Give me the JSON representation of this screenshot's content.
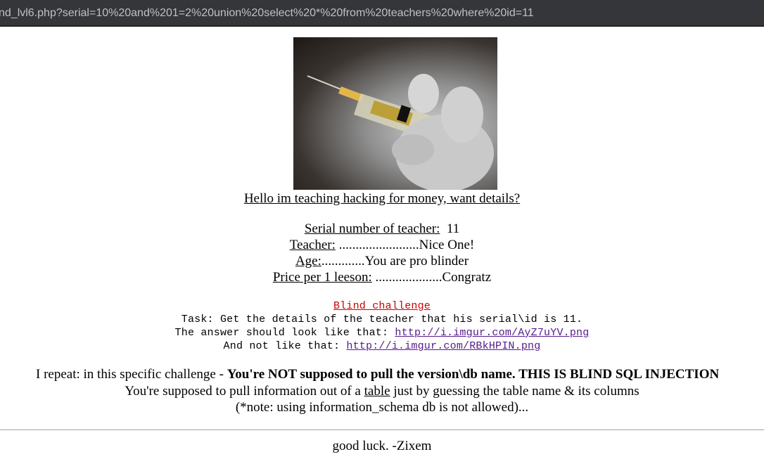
{
  "browser": {
    "url": "nd_lvl6.php?serial=10%20and%201=2%20union%20select%20*%20from%20teachers%20where%20id=11"
  },
  "header": {
    "headline": "Hello im teaching hacking for money, want details?"
  },
  "details": {
    "serial_label": "Serial number of teacher:",
    "serial_value": "11",
    "teacher_label": "Teacher:",
    "teacher_value": "........................Nice One!",
    "age_label": "Age:",
    "age_value": ".............You are pro blinder",
    "price_label": "Price per 1 leeson:",
    "price_value": "....................Congratz"
  },
  "challenge": {
    "title": "Blind challenge",
    "task": "Task: Get the details of the teacher that his serial\\id is 11.",
    "answer_prefix": "The answer should look like that:",
    "answer_link": "http://i.imgur.com/AyZ7uYV.png",
    "not_prefix": "And not like that:",
    "not_link": "http://i.imgur.com/RBkHPIN.png"
  },
  "notes": {
    "repeat_prefix": "I repeat: in this specific challenge - ",
    "repeat_bold": "You're NOT supposed to pull the version\\db name. THIS IS BLIND SQL INJECTION",
    "line2_prefix": "You're supposed to pull information out of a ",
    "line2_link": "table",
    "line2_suffix": " just by guessing the table name & its columns",
    "line3": "(*note: using information_schema db is not allowed)..."
  },
  "footer": {
    "signoff": "good luck. -Zixem"
  },
  "colors": {
    "address_bar": "#35363a",
    "address_text": "#bdc1c6",
    "challenge_link": "#cc0000",
    "visited_link": "#551a8b"
  }
}
